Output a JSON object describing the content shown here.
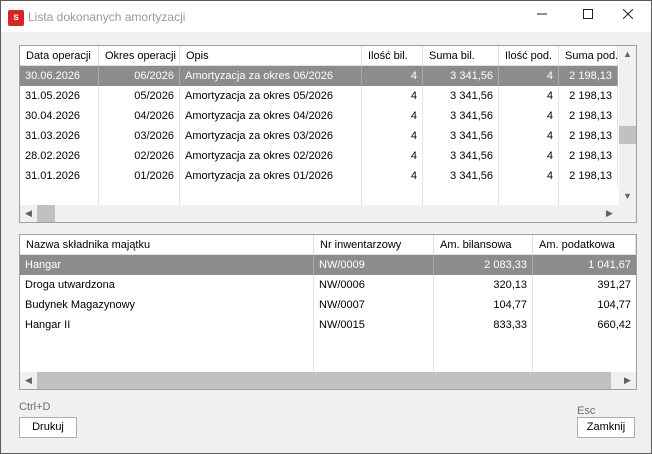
{
  "window": {
    "title": "Lista dokonanych amortyzacji",
    "icon_letter": "s"
  },
  "top_table": {
    "headers": [
      "Data operacji",
      "Okres operacji",
      "Opis",
      "Ilość bil.",
      "Suma bil.",
      "Ilość pod.",
      "Suma pod."
    ],
    "rows": [
      [
        "30.06.2026",
        "06/2026",
        "Amortyzacja za okres 06/2026",
        "4",
        "3 341,56",
        "4",
        "2 198,13"
      ],
      [
        "31.05.2026",
        "05/2026",
        "Amortyzacja za okres 05/2026",
        "4",
        "3 341,56",
        "4",
        "2 198,13"
      ],
      [
        "30.04.2026",
        "04/2026",
        "Amortyzacja za okres 04/2026",
        "4",
        "3 341,56",
        "4",
        "2 198,13"
      ],
      [
        "31.03.2026",
        "03/2026",
        "Amortyzacja za okres 03/2026",
        "4",
        "3 341,56",
        "4",
        "2 198,13"
      ],
      [
        "28.02.2026",
        "02/2026",
        "Amortyzacja za okres 02/2026",
        "4",
        "3 341,56",
        "4",
        "2 198,13"
      ],
      [
        "31.01.2026",
        "01/2026",
        "Amortyzacja za okres 01/2026",
        "4",
        "3 341,56",
        "4",
        "2 198,13"
      ]
    ]
  },
  "bottom_table": {
    "headers": [
      "Nazwa składnika majątku",
      "Nr inwentarzowy",
      "Am. bilansowa",
      "Am. podatkowa"
    ],
    "rows": [
      [
        "Hangar",
        "NW/0009",
        "2 083,33",
        "1 041,67"
      ],
      [
        "Droga utwardzona",
        "NW/0006",
        "320,13",
        "391,27"
      ],
      [
        "Budynek Magazynowy",
        "NW/0007",
        "104,77",
        "104,77"
      ],
      [
        "Hangar II",
        "NW/0015",
        "833,33",
        "660,42"
      ]
    ]
  },
  "footer": {
    "print_shortcut": "Ctrl+D",
    "print_label": "Drukuj",
    "close_shortcut": "Esc",
    "close_label": "Zamknij"
  }
}
